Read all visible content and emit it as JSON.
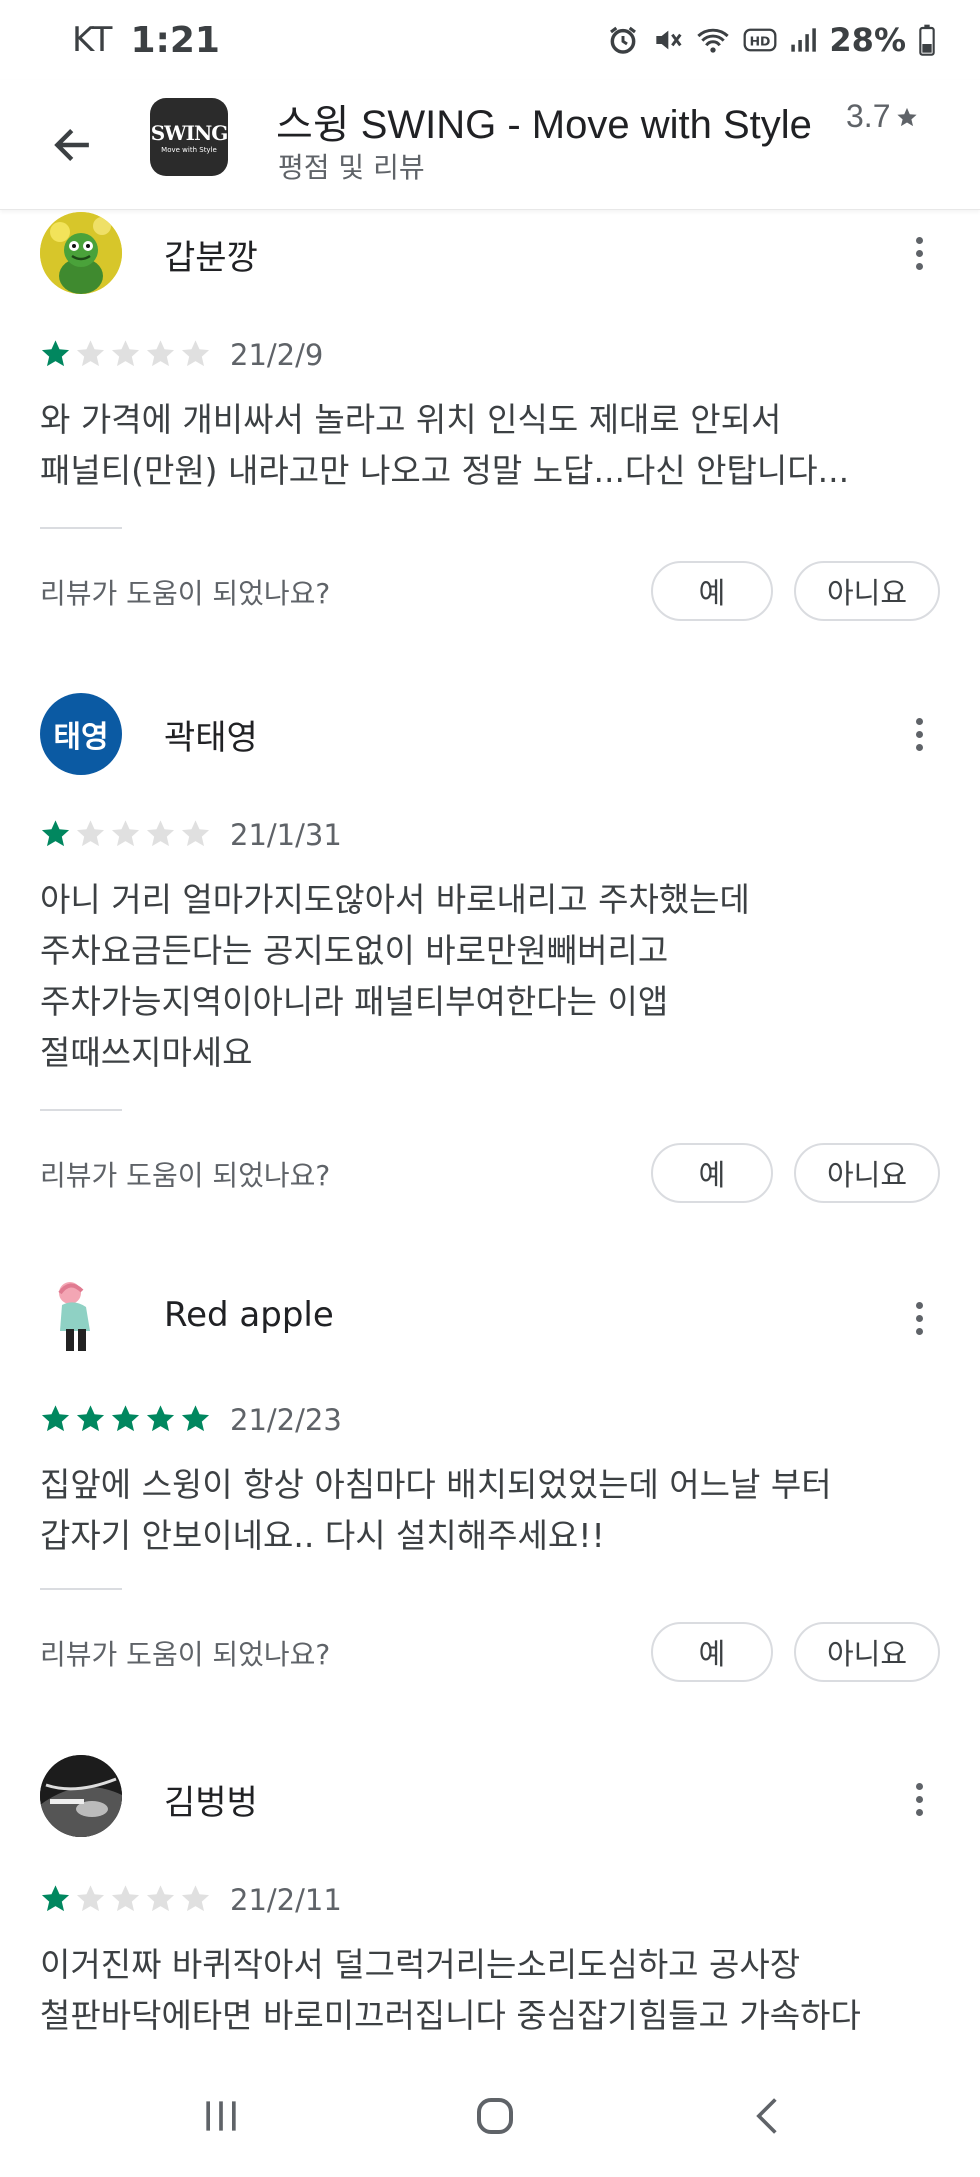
{
  "status_bar": {
    "carrier": "KT",
    "time": "1:21",
    "battery": "28%",
    "icons": [
      "alarm-icon",
      "mute-icon",
      "wifi-icon",
      "hd-icon",
      "signal-icon",
      "battery-icon"
    ]
  },
  "header": {
    "app_logo_text": "SWING",
    "app_logo_sub": "Move with Style",
    "app_title": "스윙 SWING - Move with Style",
    "rating": "3.7",
    "subtitle": "평점 및 리뷰"
  },
  "reviews": [
    {
      "name": "갑분깡",
      "stars": 1,
      "date": "21/2/9",
      "lines": [
        "와 가격에 개비싸서 놀라고 위치 인식도 제대로 안되서",
        "패널티(만원) 내라고만 나오고 정말 노답...다신 안탑니다..."
      ],
      "helpful_question": "리뷰가 도움이 되었나요?",
      "yes_label": "예",
      "no_label": "아니요"
    },
    {
      "name": "곽태영",
      "avatar_text": "태영",
      "stars": 1,
      "date": "21/1/31",
      "lines": [
        "아니 거리 얼마가지도않아서 바로내리고 주차했는데",
        "주차요금든다는 공지도없이 바로만원빼버리고",
        "주차가능지역이아니라 패널티부여한다는 이앱",
        "절때쓰지마세요"
      ],
      "helpful_question": "리뷰가 도움이 되었나요?",
      "yes_label": "예",
      "no_label": "아니요"
    },
    {
      "name": "Red apple",
      "stars": 5,
      "date": "21/2/23",
      "lines": [
        "집앞에 스윙이 항상 아침마다 배치되었었는데 어느날 부터",
        "갑자기 안보이네요.. 다시 설치해주세요!!"
      ],
      "helpful_question": "리뷰가 도움이 되었나요?",
      "yes_label": "예",
      "no_label": "아니요"
    },
    {
      "name": "김벙벙",
      "stars": 1,
      "date": "21/2/11",
      "lines": [
        "이거진짜 바퀴작아서 덜그럭거리는소리도심하고 공사장",
        "철판바닥에타면 바로미끄러집니다 중심잡기힘들고 가속하다"
      ]
    }
  ],
  "colors": {
    "star_filled": "#01875f",
    "star_empty": "#e0e0e0",
    "avatar_blue": "#0b5aa3"
  }
}
